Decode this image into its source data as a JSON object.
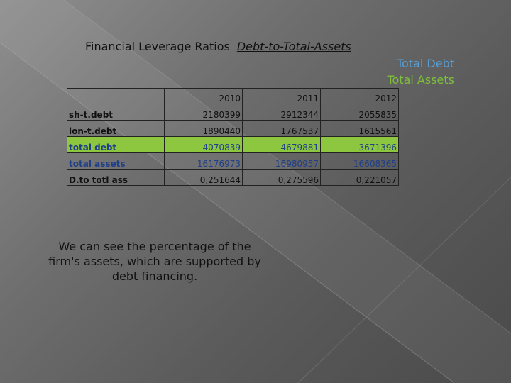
{
  "title": {
    "main": "Financial Leverage Ratios",
    "sub": "Debt-to-Total-Assets"
  },
  "formula": {
    "numerator": "Total Debt",
    "denominator": "Total Assets"
  },
  "table": {
    "headers": [
      "",
      "2010",
      "2011",
      "2012"
    ],
    "rows": [
      {
        "label": "sh-t.debt",
        "values": [
          "2180399",
          "2912344",
          "2055835"
        ]
      },
      {
        "label": "lon-t.debt",
        "values": [
          "1890440",
          "1767537",
          "1615561"
        ]
      },
      {
        "label": "total debt",
        "values": [
          "4070839",
          "4679881",
          "3671396"
        ]
      },
      {
        "label": "total assets",
        "values": [
          "16176973",
          "16980957",
          "16608365"
        ]
      },
      {
        "label": "D.to totl ass",
        "values": [
          "0,251644",
          "0,275596",
          "0,221057"
        ]
      }
    ]
  },
  "note": "We can see the percentage of the firm's assets, which are supported by debt financing.",
  "colors": {
    "highlight_row": "#8dc63f",
    "formula_numerator": "#5a9fd4",
    "formula_denominator": "#7dbf3a",
    "blue_text": "#1f3f8a"
  }
}
